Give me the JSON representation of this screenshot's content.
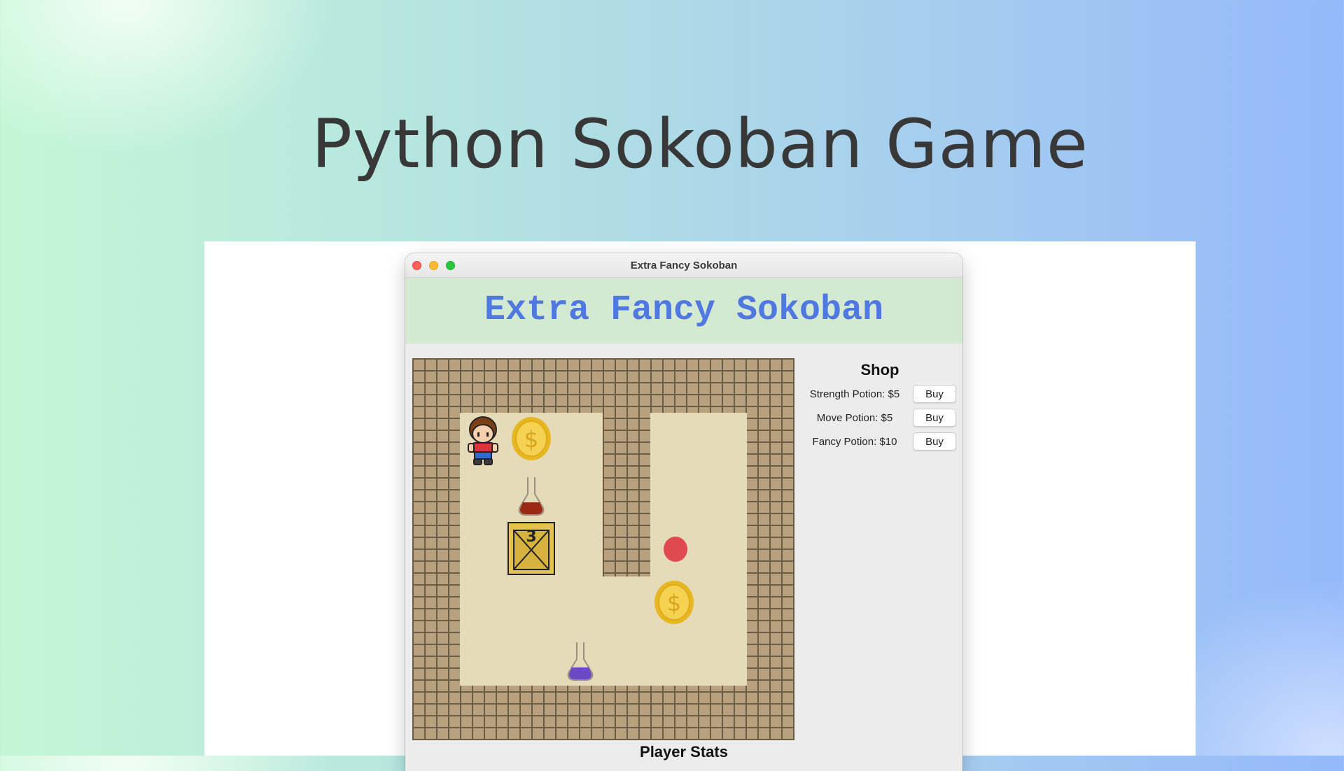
{
  "page": {
    "title": "Python Sokoban Game"
  },
  "window": {
    "title": "Extra Fancy Sokoban"
  },
  "game": {
    "banner": "Extra Fancy Sokoban",
    "crate_label": "3",
    "colors": {
      "wall": "#b7a17e",
      "floor": "#e6dbb9",
      "banner_bg": "#d4e9d1",
      "banner_text": "#4f78e0",
      "goal": "#de4a50"
    }
  },
  "shop": {
    "title": "Shop",
    "items": [
      {
        "label": "Strength Potion: $5",
        "button": "Buy"
      },
      {
        "label": "Move Potion: $5",
        "button": "Buy"
      },
      {
        "label": "Fancy Potion: $10",
        "button": "Buy"
      }
    ]
  },
  "player_stats": {
    "title": "Player Stats"
  }
}
